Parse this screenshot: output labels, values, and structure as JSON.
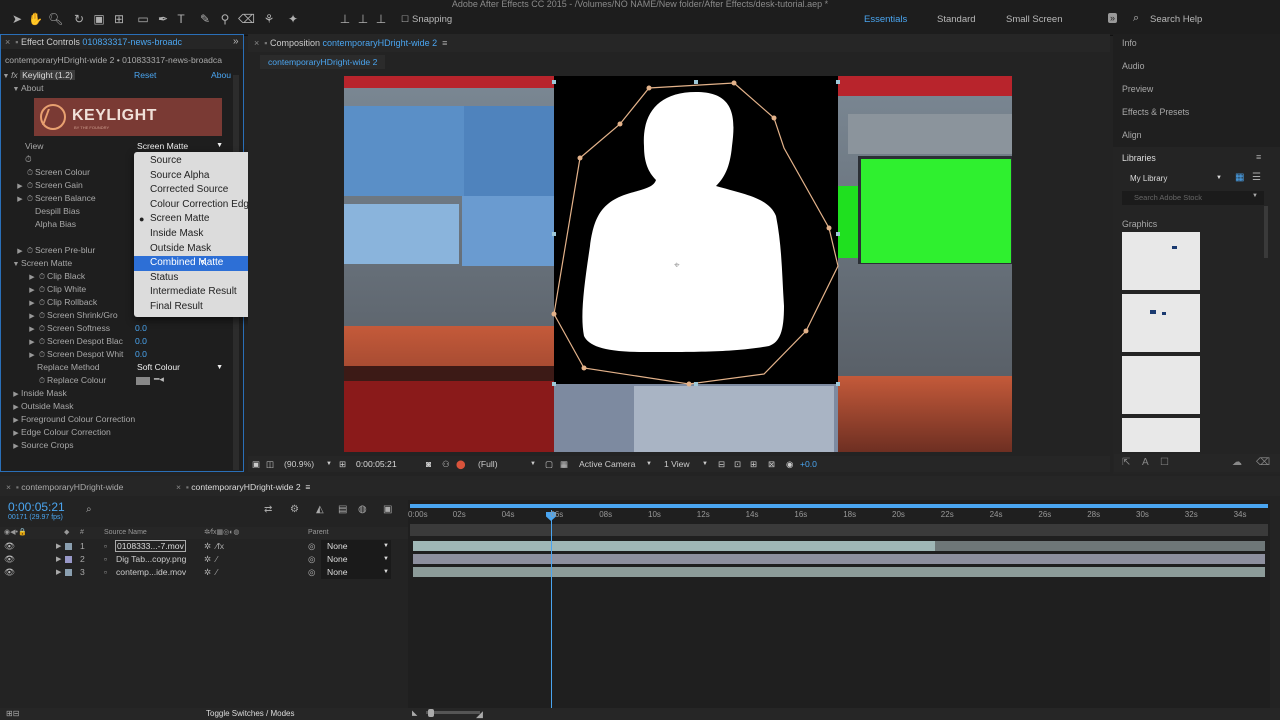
{
  "app": {
    "title": "Adobe After Effects CC 2015 - /Volumes/NO NAME/New folder/After Effects/desk-tutorial.aep *",
    "snapping_label": "Snapping",
    "workspaces": [
      "Essentials",
      "Standard",
      "Small Screen"
    ],
    "search_help": "Search Help"
  },
  "effect_controls": {
    "tab_prefix": "Effect Controls",
    "tab_layer": "010833317-news-broadc",
    "breadcrumb": "contemporaryHDright-wide 2 • 010833317-news-broadca",
    "effect_name": "Keylight (1.2)",
    "reset_label": "Reset",
    "about_label": "Abou",
    "about_group": "About",
    "logo_text": "KEYLIGHT",
    "logo_sub": "BY THE FOUNDRY",
    "view_label": "View",
    "view_value": "Screen Matte",
    "props": [
      {
        "label": "Screen Colour",
        "twirl": false
      },
      {
        "label": "Screen Gain",
        "twirl": true
      },
      {
        "label": "Screen Balance",
        "twirl": true
      },
      {
        "label": "Despill Bias",
        "twirl": false
      },
      {
        "label": "Alpha Bias",
        "twirl": false
      }
    ],
    "pre_blur": "Screen Pre-blur",
    "screen_matte_group": "Screen Matte",
    "matte_props": [
      {
        "label": "Clip Black",
        "value": ""
      },
      {
        "label": "Clip White",
        "value": ""
      },
      {
        "label": "Clip Rollback",
        "value": ""
      },
      {
        "label": "Screen Shrink/Gro",
        "value": ""
      },
      {
        "label": "Screen Softness",
        "value": "0.0"
      },
      {
        "label": "Screen Despot Blac",
        "value": "0.0"
      },
      {
        "label": "Screen Despot Whit",
        "value": "0.0"
      }
    ],
    "replace_method_label": "Replace Method",
    "replace_method_value": "Soft Colour",
    "replace_colour_label": "Replace Colour",
    "groups": [
      "Inside Mask",
      "Outside Mask",
      "Foreground Colour Correction",
      "Edge Colour Correction",
      "Source Crops"
    ]
  },
  "view_menu": {
    "items": [
      "Source",
      "Source Alpha",
      "Corrected Source",
      "Colour Correction Edges",
      "Screen Matte",
      "Inside Mask",
      "Outside Mask",
      "Combined Matte",
      "Status",
      "Intermediate Result",
      "Final Result"
    ],
    "checked_index": 4,
    "hover_index": 7
  },
  "composition": {
    "tab_prefix": "Composition",
    "tab_name": "contemporaryHDright-wide 2",
    "subtab": "contemporaryHDright-wide 2",
    "zoom": "(90.9%)",
    "timecode": "0:00:05:21",
    "resolution": "(Full)",
    "camera": "Active Camera",
    "views": "1 View",
    "exposure": "+0.0"
  },
  "right_panel": {
    "items": [
      "Info",
      "Audio",
      "Preview",
      "Effects & Presets",
      "Align"
    ],
    "libraries_label": "Libraries",
    "library_select": "My Library",
    "stock_placeholder": "Search Adobe Stock",
    "graphics_label": "Graphics"
  },
  "timeline": {
    "tabs": [
      "contemporaryHDright-wide",
      "contemporaryHDright-wide 2"
    ],
    "timecode": "0:00:05:21",
    "frames": "00171 (29.97 fps)",
    "col_source": "Source Name",
    "col_num": "#",
    "col_parent": "Parent",
    "layers": [
      {
        "num": "1",
        "name": "0108333...-7.mov",
        "parent": "None",
        "color": "#8a9fb0"
      },
      {
        "num": "2",
        "name": "Dig Tab...copy.png",
        "parent": "None",
        "color": "#9898c8"
      },
      {
        "num": "3",
        "name": "contemp...ide.mov",
        "parent": "None",
        "color": "#8a9fb0"
      }
    ],
    "ruler": [
      "0:00s",
      "02s",
      "04s",
      "06s",
      "08s",
      "10s",
      "12s",
      "14s",
      "16s",
      "18s",
      "20s",
      "22s",
      "24s",
      "26s",
      "28s",
      "30s",
      "32s",
      "34s"
    ],
    "toggle_label": "Toggle Switches / Modes"
  }
}
